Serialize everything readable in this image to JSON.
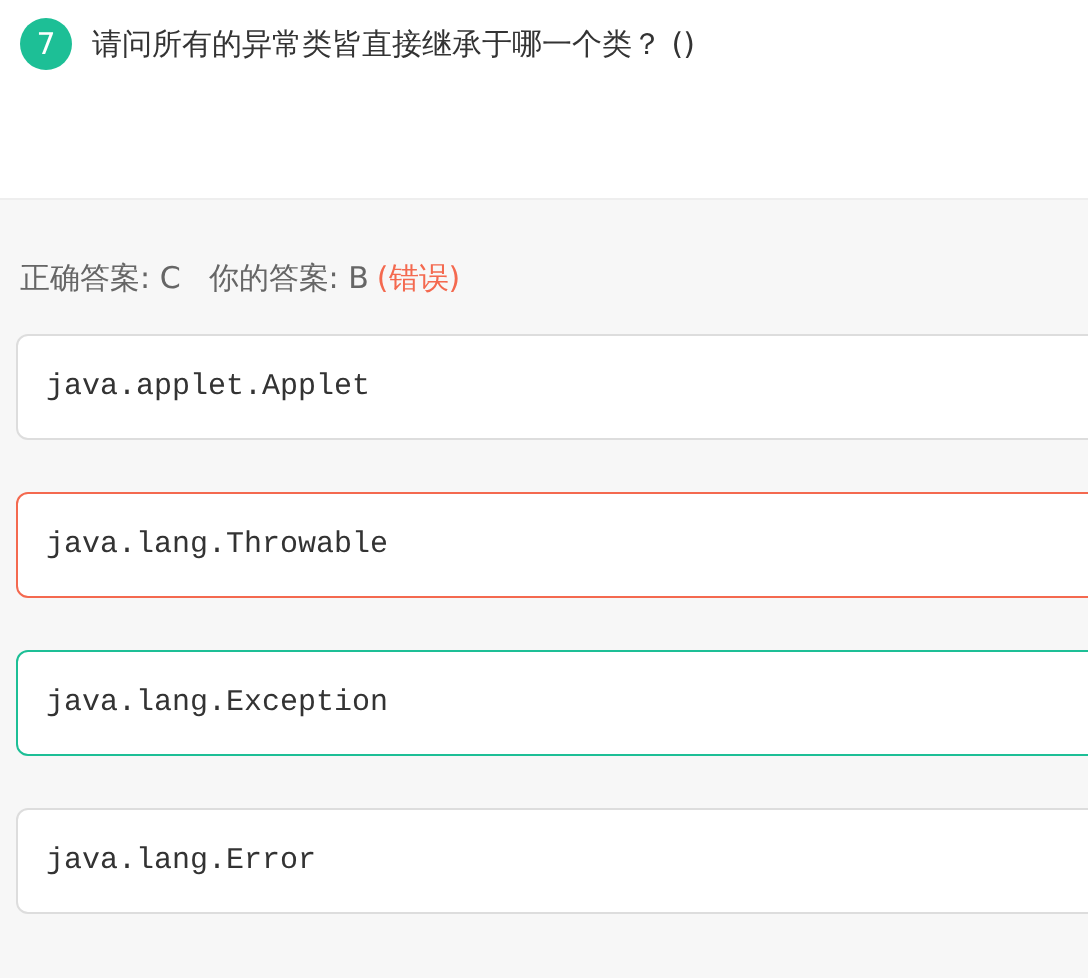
{
  "question": {
    "number": "7",
    "text": "请问所有的异常类皆直接继承于哪一个类？ ()"
  },
  "answer": {
    "correct": "正确答案: C",
    "yours": "你的答案: B",
    "verdict": "(错误)"
  },
  "options": [
    {
      "text": "java.applet.Applet",
      "selected": false,
      "correct": false
    },
    {
      "text": "java.lang.Throwable",
      "selected": true,
      "correct": false
    },
    {
      "text": "java.lang.Exception",
      "selected": false,
      "correct": true
    },
    {
      "text": "java.lang.Error",
      "selected": false,
      "correct": false
    }
  ]
}
